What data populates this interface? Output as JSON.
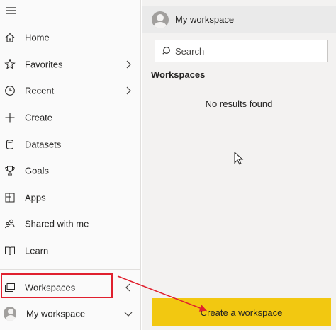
{
  "nav": {
    "items": [
      {
        "label": "Home",
        "icon": "home-icon",
        "chevron": ""
      },
      {
        "label": "Favorites",
        "icon": "star-icon",
        "chevron": "right"
      },
      {
        "label": "Recent",
        "icon": "clock-icon",
        "chevron": "right"
      },
      {
        "label": "Create",
        "icon": "plus-icon",
        "chevron": ""
      },
      {
        "label": "Datasets",
        "icon": "database-icon",
        "chevron": ""
      },
      {
        "label": "Goals",
        "icon": "trophy-icon",
        "chevron": ""
      },
      {
        "label": "Apps",
        "icon": "apps-icon",
        "chevron": ""
      },
      {
        "label": "Shared with me",
        "icon": "shared-icon",
        "chevron": ""
      },
      {
        "label": "Learn",
        "icon": "book-icon",
        "chevron": ""
      },
      {
        "label": "Workspaces",
        "icon": "workspaces-icon",
        "chevron": "left"
      },
      {
        "label": "My workspace",
        "icon": "avatar",
        "chevron": "down"
      }
    ]
  },
  "flyout": {
    "title": "My workspace",
    "search_placeholder": "Search",
    "section_label": "Workspaces",
    "empty_text": "No results found",
    "create_button_label": "Create a workspace"
  },
  "colors": {
    "accent_button": "#f2c811",
    "annotation": "#e0202e",
    "flyout_bg": "#f3f2f1",
    "nav_bg": "#fafafa"
  }
}
